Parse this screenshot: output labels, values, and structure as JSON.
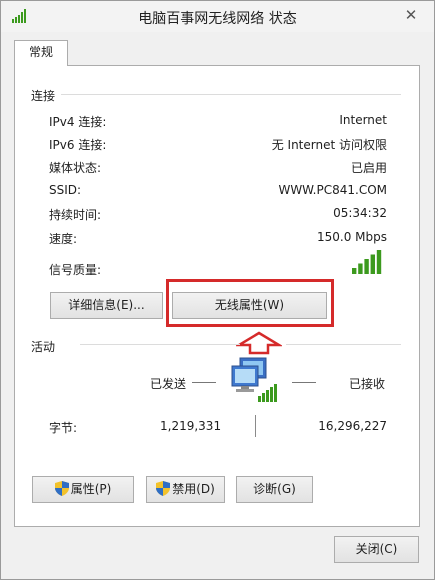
{
  "window": {
    "title": "电脑百事网无线网络 状态",
    "close_glyph": "✕"
  },
  "tabs": [
    {
      "label": "常规"
    }
  ],
  "connection": {
    "section_title": "连接",
    "rows": [
      {
        "label": "IPv4 连接:",
        "value": "Internet"
      },
      {
        "label": "IPv6 连接:",
        "value": "无 Internet 访问权限"
      },
      {
        "label": "媒体状态:",
        "value": "已启用"
      },
      {
        "label": "SSID:",
        "value": "WWW.PC841.COM"
      },
      {
        "label": "持续时间:",
        "value": "05:34:32"
      },
      {
        "label": "速度:",
        "value": "150.0 Mbps"
      }
    ],
    "signal_label": "信号质量:",
    "signal_bars": 5,
    "signal_max": 5,
    "details_button": "详细信息(E)...",
    "wireless_props_button": "无线属性(W)"
  },
  "activity": {
    "section_title": "活动",
    "sent_label": "已发送",
    "received_label": "已接收",
    "bytes_label": "字节:",
    "bytes_sent": "1,219,331",
    "bytes_received": "16,296,227"
  },
  "action_buttons": [
    {
      "label": "属性(P)",
      "icon": "shield-icon"
    },
    {
      "label": "禁用(D)",
      "icon": "shield-icon"
    },
    {
      "label": "诊断(G)"
    }
  ],
  "footer": {
    "close_button": "关闭(C)"
  },
  "colors": {
    "signal_green": "#3c9a1e",
    "annotation_red": "#d52a2a"
  }
}
